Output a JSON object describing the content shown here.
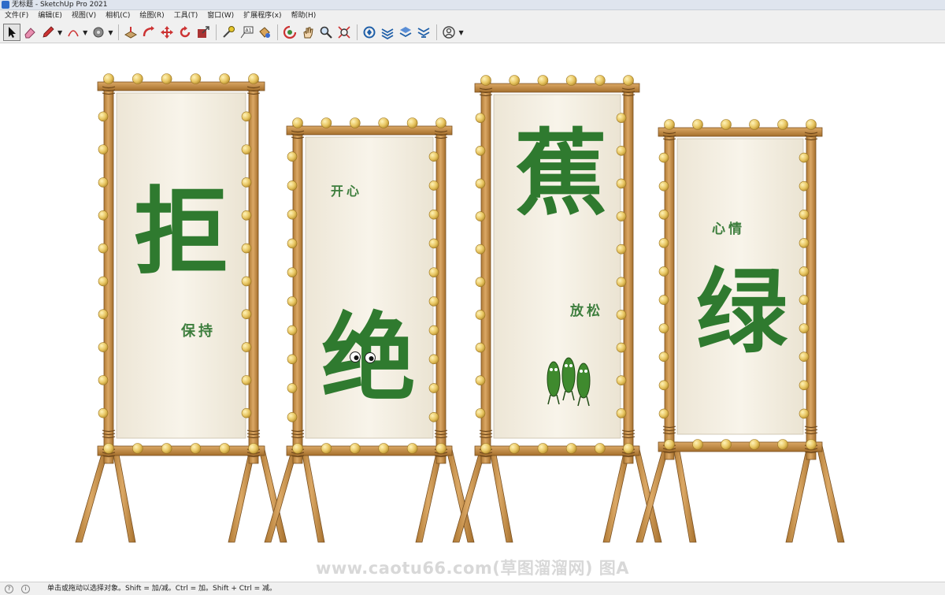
{
  "window": {
    "title": "无标题 - SketchUp Pro 2021"
  },
  "menu": [
    "文件(F)",
    "编辑(E)",
    "视图(V)",
    "相机(C)",
    "绘图(R)",
    "工具(T)",
    "窗口(W)",
    "扩展程序(x)",
    "帮助(H)"
  ],
  "toolbar": {
    "tools": [
      "select-icon",
      "eraser-icon",
      "pencil-icon",
      "arc-icon",
      "shape-icon",
      "push-pull-icon",
      "follow-me-icon",
      "move-icon",
      "rotate-icon",
      "scale-icon",
      "tape-measure-icon",
      "text-icon",
      "paint-bucket-icon",
      "orbit-icon",
      "pan-icon",
      "zoom-icon",
      "zoom-extents-icon",
      "warehouse-icon",
      "extension-warehouse-icon",
      "layout-icon",
      "send-to-layout-icon",
      "account-icon"
    ]
  },
  "banners": [
    {
      "main": "拒",
      "sub": "保持"
    },
    {
      "main": "绝",
      "sub": "开心"
    },
    {
      "main": "蕉",
      "sub": "放松"
    },
    {
      "main": "绿",
      "sub": "心情"
    }
  ],
  "watermark": "www.caotu66.com(草图溜溜网) 图A",
  "status": {
    "text": "单击或拖动以选择对象。Shift = 加/减。Ctrl = 加。Shift + Ctrl = 减。"
  },
  "colors": {
    "bamboo": "#d19a52",
    "bead": "#e8c662",
    "cloth": "#f6f1e6",
    "calligraphy": "#2f7a2f"
  }
}
